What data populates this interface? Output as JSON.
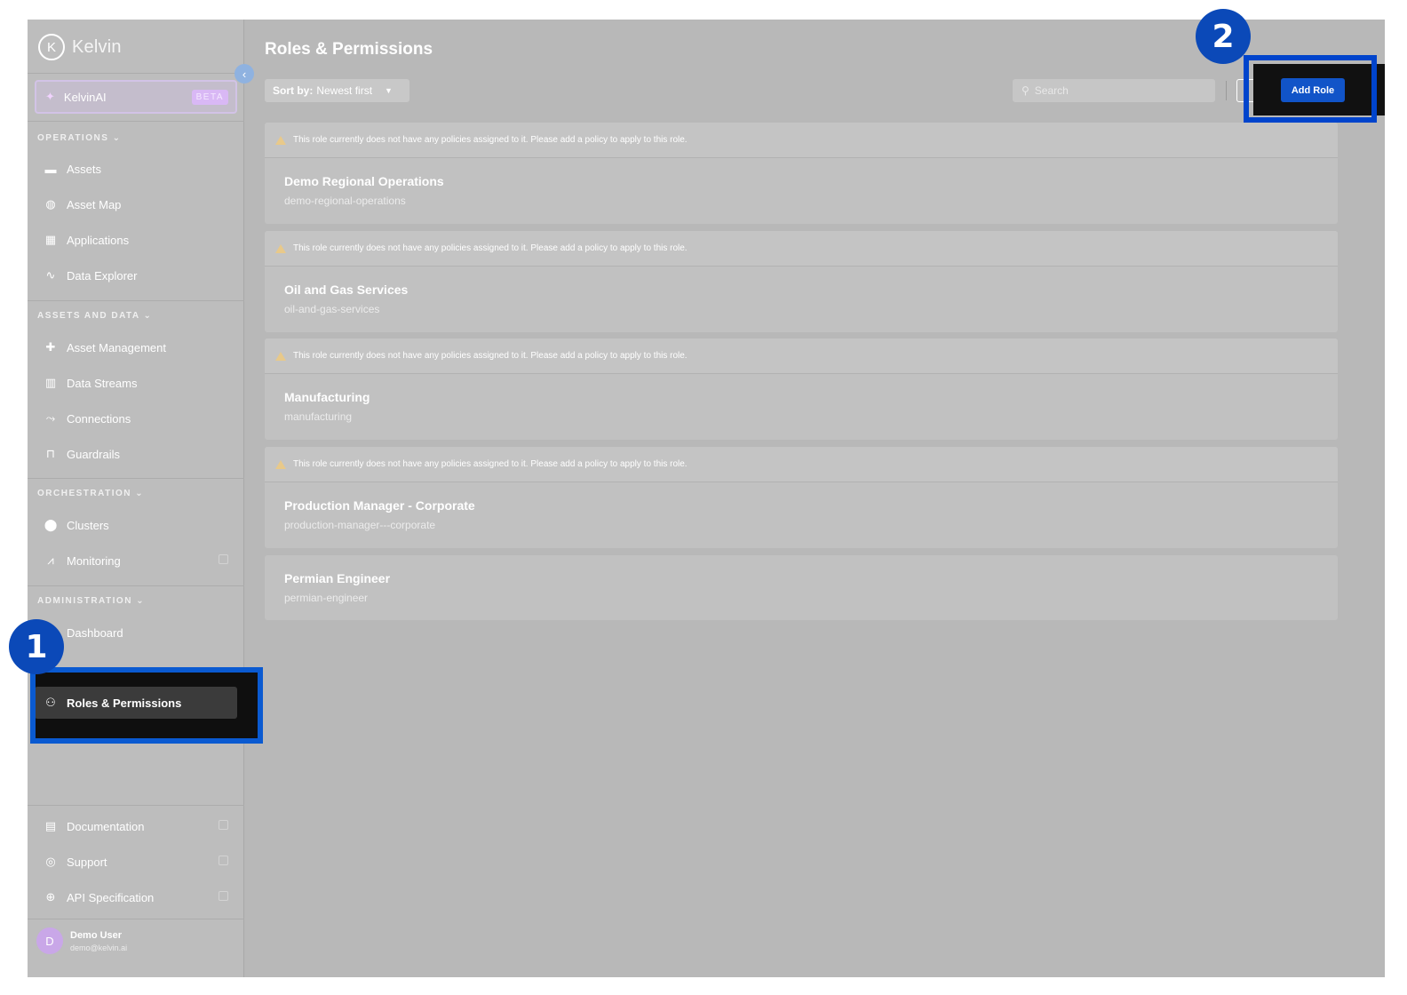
{
  "brand": {
    "name": "Kelvin"
  },
  "kelvinai": {
    "label": "KelvinAI",
    "badge": "BETA"
  },
  "sections": {
    "operations": "OPERATIONS",
    "assets_and_data": "ASSETS AND DATA",
    "orchestration": "ORCHESTRATION",
    "administration": "ADMINISTRATION"
  },
  "nav": {
    "assets": "Assets",
    "asset_map": "Asset Map",
    "applications": "Applications",
    "data_explorer": "Data Explorer",
    "asset_management": "Asset Management",
    "data_streams": "Data Streams",
    "connections": "Connections",
    "guardrails": "Guardrails",
    "clusters": "Clusters",
    "monitoring": "Monitoring",
    "dashboard": "Dashboard",
    "roles_permissions": "Roles & Permissions",
    "documentation": "Documentation",
    "support": "Support",
    "api_specification": "API Specification"
  },
  "user": {
    "initial": "D",
    "name": "Demo User",
    "email": "demo@kelvin.ai"
  },
  "page": {
    "title": "Roles & Permissions"
  },
  "toolbar": {
    "sort_prefix": "Sort by:",
    "sort_value": "Newest first",
    "search_placeholder": "Search",
    "add_role": "Add Role"
  },
  "warning_text": "This role currently does not have any policies assigned to it. Please add a policy to apply to this role.",
  "roles": [
    {
      "name": "Demo Regional Operations",
      "slug": "demo-regional-operations",
      "warning": true
    },
    {
      "name": "Oil and Gas Services",
      "slug": "oil-and-gas-services",
      "warning": true
    },
    {
      "name": "Manufacturing",
      "slug": "manufacturing",
      "warning": true
    },
    {
      "name": "Production Manager - Corporate",
      "slug": "production-manager---corporate",
      "warning": true
    },
    {
      "name": "Permian Engineer",
      "slug": "permian-engineer",
      "warning": false
    }
  ],
  "annotations": {
    "step1": "1",
    "step2": "2"
  },
  "colors": {
    "highlight": "#0044cc",
    "primary_button": "#1154c8",
    "overlay": "#b8b8b8"
  }
}
